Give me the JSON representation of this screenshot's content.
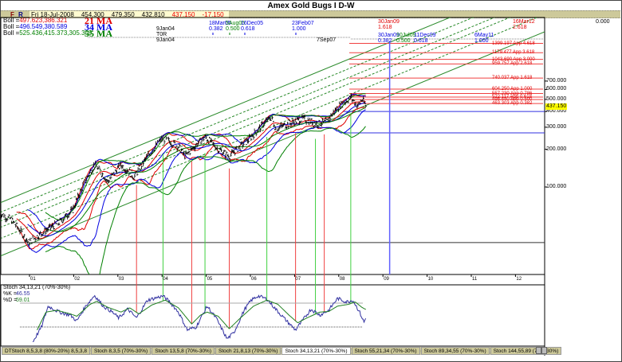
{
  "title": "Amex Gold Bugs I D-W",
  "infobar": {
    "f": "F",
    "r": "R",
    "date": "Fri 18-Jul-2008",
    "open": "454.300",
    "high": "479.350",
    "low": "432.810",
    "close": "437.150",
    "change": "-17.150"
  },
  "legend": [
    {
      "label": "Boll =",
      "values": "497.623,386.321",
      "ma": "21 MA",
      "color": "#e00000"
    },
    {
      "label": "Boll =",
      "values": "496.549,380.589",
      "ma": "34 MA",
      "color": "#0000e0"
    },
    {
      "label": "Boll =",
      "values": "525.436,415.373,305.309",
      "ma": "55 MA",
      "color": "#008000"
    }
  ],
  "fib_time_top": [
    {
      "date": "18Mar05",
      "ratio": "0.382",
      "color": "#0000e0"
    },
    {
      "date": "5Aug05",
      "ratio": "0.500",
      "color": "#008000"
    },
    {
      "date": "16Dec05",
      "ratio": "0.618",
      "color": "#0000e0"
    },
    {
      "date": "23Feb07",
      "ratio": "1.000",
      "color": "#0000e0"
    }
  ],
  "fib_time_proj": [
    {
      "date": "30Jan09",
      "ratio": "1.618",
      "color": "#e00000"
    },
    {
      "date": "16Mar12",
      "ratio": "2.618",
      "color": "#e00000"
    },
    {
      "date": "30Jan09",
      "ratio": "0.382",
      "color": "#0000e0"
    },
    {
      "date": "10Jul09",
      "ratio": "0.500",
      "color": "#008000"
    },
    {
      "date": "11Dec09",
      "ratio": "0.618",
      "color": "#0000e0"
    },
    {
      "date": "6May11",
      "ratio": "1.000",
      "color": "#0000e0"
    }
  ],
  "anchors": {
    "start1": "9Jan04",
    "tor": "T0R",
    "start2": "9Jan04",
    "end": "7Sep07",
    "corner_value": "0.000"
  },
  "fib_price_levels": [
    {
      "price": 1399.197,
      "label": "1399.197 App 4.618"
    },
    {
      "price": 1179.477,
      "label": "1179.477 App 3.618"
    },
    {
      "price": 1043.69,
      "label": "1043.690 App 3.000"
    },
    {
      "price": 959.757,
      "label": "959.757 App 2.618"
    },
    {
      "price": 740.037,
      "label": "740.037 App 1.618"
    },
    {
      "price": 604.25,
      "label": "604.250 App 1.000"
    },
    {
      "price": 557.23,
      "label": "557.230 App 0.786"
    },
    {
      "price": 522.117,
      "label": "522.117 App 0.618"
    },
    {
      "price": 498.44,
      "label": "498.440 App 0.500"
    },
    {
      "price": 463.303,
      "label": "463.303 App 0.382"
    }
  ],
  "last_price": "437.150",
  "chart_data": [
    {
      "type": "line",
      "title": "Amex Gold Bugs I D-W",
      "scale": "log",
      "ylim": [
        30,
        1500
      ],
      "y_ticks": [
        "700.000",
        "600.000",
        "500.000",
        "400.000",
        "300.000",
        "200.000",
        "100.000"
      ],
      "y_tick_values": [
        700,
        600,
        500,
        400,
        300,
        200,
        100
      ],
      "x_ticks": [
        "01",
        "02",
        "03",
        "04",
        "05",
        "06",
        "07",
        "08",
        "09",
        "10",
        "11",
        "12"
      ],
      "x_tick_years": [
        2001,
        2002,
        2003,
        2004,
        2005,
        2006,
        2007,
        2008,
        2009,
        2010,
        2011,
        2012
      ],
      "xlim": [
        2000.25,
        2012.65
      ],
      "price_keypoints": [
        [
          2000.25,
          62
        ],
        [
          2000.5,
          55
        ],
        [
          2000.9,
          36
        ],
        [
          2001.3,
          45
        ],
        [
          2001.6,
          52
        ],
        [
          2001.9,
          65
        ],
        [
          2002.1,
          95
        ],
        [
          2002.4,
          150
        ],
        [
          2002.7,
          110
        ],
        [
          2003.0,
          150
        ],
        [
          2003.3,
          120
        ],
        [
          2003.6,
          175
        ],
        [
          2003.95,
          245
        ],
        [
          2004.3,
          210
        ],
        [
          2004.45,
          175
        ],
        [
          2004.9,
          250
        ],
        [
          2005.2,
          200
        ],
        [
          2005.45,
          175
        ],
        [
          2005.9,
          240
        ],
        [
          2006.4,
          360
        ],
        [
          2006.5,
          290
        ],
        [
          2006.9,
          330
        ],
        [
          2007.1,
          350
        ],
        [
          2007.45,
          320
        ],
        [
          2007.65,
          330
        ],
        [
          2007.9,
          430
        ],
        [
          2008.2,
          520
        ],
        [
          2008.35,
          440
        ],
        [
          2008.45,
          500
        ],
        [
          2008.55,
          437
        ]
      ],
      "series": [
        "Price",
        "21 MA",
        "34 MA",
        "55 MA",
        "Bollinger bands"
      ],
      "vertical_markers": {
        "red": [
          2003.35,
          2004.6,
          2005.45,
          2006.95,
          2007.6
        ],
        "green": [
          2003.95,
          2004.9,
          2006.3,
          2007.4,
          2008.2
        ],
        "blue": [
          2009.08
        ]
      },
      "support_lines": [
        36,
        270,
        400
      ]
    },
    {
      "type": "line",
      "title": "Stoch 34,13,21 (70%-30%)",
      "ylim": [
        0,
        100
      ],
      "levels": [
        70,
        30
      ],
      "k_label": "%K =",
      "k_value": "46.55",
      "d_label": "%D =",
      "d_value": "59.01",
      "k_keypoints": [
        [
          2001.0,
          5
        ],
        [
          2001.2,
          30
        ],
        [
          2001.35,
          65
        ],
        [
          2001.6,
          55
        ],
        [
          2001.85,
          50
        ],
        [
          2002.0,
          40
        ],
        [
          2002.2,
          65
        ],
        [
          2002.4,
          83
        ],
        [
          2002.6,
          65
        ],
        [
          2002.8,
          55
        ],
        [
          2002.95,
          45
        ],
        [
          2003.15,
          60
        ],
        [
          2003.35,
          45
        ],
        [
          2003.6,
          75
        ],
        [
          2003.95,
          82
        ],
        [
          2004.1,
          72
        ],
        [
          2004.3,
          55
        ],
        [
          2004.5,
          25
        ],
        [
          2004.7,
          30
        ],
        [
          2004.95,
          65
        ],
        [
          2005.15,
          45
        ],
        [
          2005.4,
          10
        ],
        [
          2005.55,
          20
        ],
        [
          2005.8,
          60
        ],
        [
          2005.95,
          75
        ],
        [
          2006.1,
          82
        ],
        [
          2006.3,
          77
        ],
        [
          2006.5,
          60
        ],
        [
          2006.75,
          40
        ],
        [
          2006.95,
          25
        ],
        [
          2007.1,
          40
        ],
        [
          2007.3,
          60
        ],
        [
          2007.5,
          50
        ],
        [
          2007.7,
          58
        ],
        [
          2007.9,
          78
        ],
        [
          2008.1,
          72
        ],
        [
          2008.25,
          75
        ],
        [
          2008.4,
          55
        ],
        [
          2008.5,
          38
        ],
        [
          2008.55,
          46.55
        ]
      ],
      "d_keypoints": [
        [
          2001.1,
          25
        ],
        [
          2001.3,
          55
        ],
        [
          2001.55,
          58
        ],
        [
          2001.85,
          52
        ],
        [
          2002.0,
          48
        ],
        [
          2002.3,
          68
        ],
        [
          2002.45,
          73
        ],
        [
          2002.7,
          63
        ],
        [
          2003.0,
          55
        ],
        [
          2003.2,
          62
        ],
        [
          2003.4,
          52
        ],
        [
          2003.7,
          67
        ],
        [
          2004.0,
          75
        ],
        [
          2004.3,
          62
        ],
        [
          2004.6,
          35
        ],
        [
          2004.8,
          50
        ],
        [
          2004.95,
          55
        ],
        [
          2005.2,
          48
        ],
        [
          2005.45,
          27
        ],
        [
          2005.7,
          45
        ],
        [
          2006.0,
          65
        ],
        [
          2006.3,
          75
        ],
        [
          2006.55,
          68
        ],
        [
          2006.8,
          50
        ],
        [
          2007.0,
          37
        ],
        [
          2007.2,
          45
        ],
        [
          2007.5,
          55
        ],
        [
          2007.7,
          56
        ],
        [
          2007.9,
          65
        ],
        [
          2008.15,
          68
        ],
        [
          2008.3,
          72
        ],
        [
          2008.45,
          63
        ],
        [
          2008.55,
          59.01
        ]
      ]
    }
  ],
  "tabs": [
    "DTStoch 8,5,3,8 (80%-20%) 8,5,3,8",
    "Stoch 8,3,5 (70%-30%)",
    "Stoch 13,5,8 (70%-30%)",
    "Stoch 21,8,13 (70%-30%)",
    "Stoch 34,13,21 (70%-30%)",
    "Stoch 55,21,34 (70%-30%)",
    "Stoch 89,34,55 (70%-30%)",
    "Stoch 144,55,89 (70%-30%)"
  ],
  "active_tab": 4,
  "colors": {
    "up": "#e00000",
    "down": "#0000e0",
    "green": "#008000",
    "panel": "#cdc99a",
    "highlight": "#ffff00"
  }
}
